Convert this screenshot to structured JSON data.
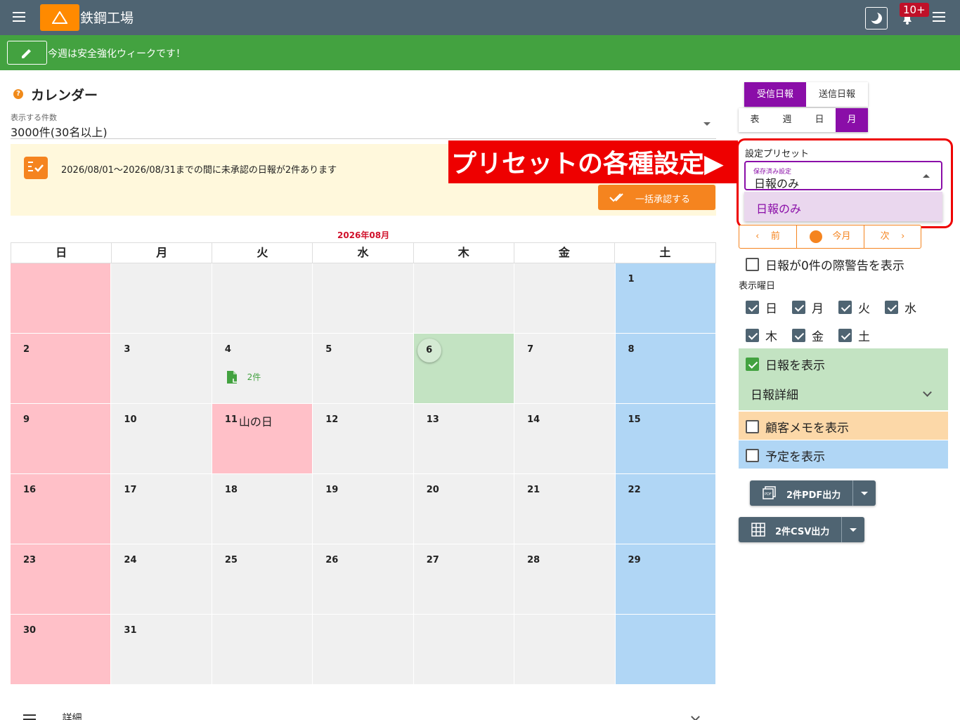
{
  "app": {
    "title": "鉄鋼工場",
    "notification_count": "10+"
  },
  "notice": {
    "text": "今週は安全強化ウィークです！"
  },
  "page": {
    "title": "カレンダー",
    "count_label": "表示する件数",
    "count_value": "3000件(30名以上)"
  },
  "alert": {
    "text": "2026/08/01〜2026/08/31までの間に未承認の日報が2件あります",
    "approve_label": "一括承認する"
  },
  "callout": {
    "text": "プリセットの各種設定▶"
  },
  "calendar": {
    "month": "2026年08月",
    "weekdays": [
      "日",
      "月",
      "火",
      "水",
      "木",
      "金",
      "土"
    ],
    "weeks": [
      [
        "",
        "",
        "",
        "",
        "",
        "",
        "1"
      ],
      [
        "2",
        "3",
        "4",
        "5",
        "6",
        "7",
        "8"
      ],
      [
        "9",
        "10",
        "11",
        "12",
        "13",
        "14",
        "15"
      ],
      [
        "16",
        "17",
        "18",
        "19",
        "20",
        "21",
        "22"
      ],
      [
        "23",
        "24",
        "25",
        "26",
        "27",
        "28",
        "29"
      ],
      [
        "30",
        "31",
        "",
        "",
        "",
        "",
        ""
      ]
    ],
    "holiday_name": "山の日",
    "report_count": "2件",
    "today": "6"
  },
  "detail": {
    "label": "詳細"
  },
  "tabs": {
    "received": "受信日報",
    "sent": "送信日報"
  },
  "views": [
    "表",
    "週",
    "日",
    "月"
  ],
  "preset": {
    "label": "設定プリセット",
    "select_label": "保存済み設定",
    "selected": "日報のみ",
    "option": "日報のみ"
  },
  "nav": {
    "prev": "前",
    "today": "今月",
    "next": "次"
  },
  "options": {
    "warn_zero": "日報が0件の際警告を表示",
    "days_label": "表示曜日",
    "days": [
      "日",
      "月",
      "火",
      "水",
      "木",
      "金",
      "土"
    ],
    "show_reports": "日報を表示",
    "report_detail": "日報詳細",
    "show_memo": "顧客メモを表示",
    "show_schedule": "予定を表示"
  },
  "export": {
    "pdf": "2件PDF出力",
    "csv": "2件CSV出力"
  },
  "colors": {
    "header": "#4f6472",
    "notice": "#43a240",
    "accent": "#f5841f",
    "purple": "#8a0ea8",
    "callout": "#ee0000"
  }
}
